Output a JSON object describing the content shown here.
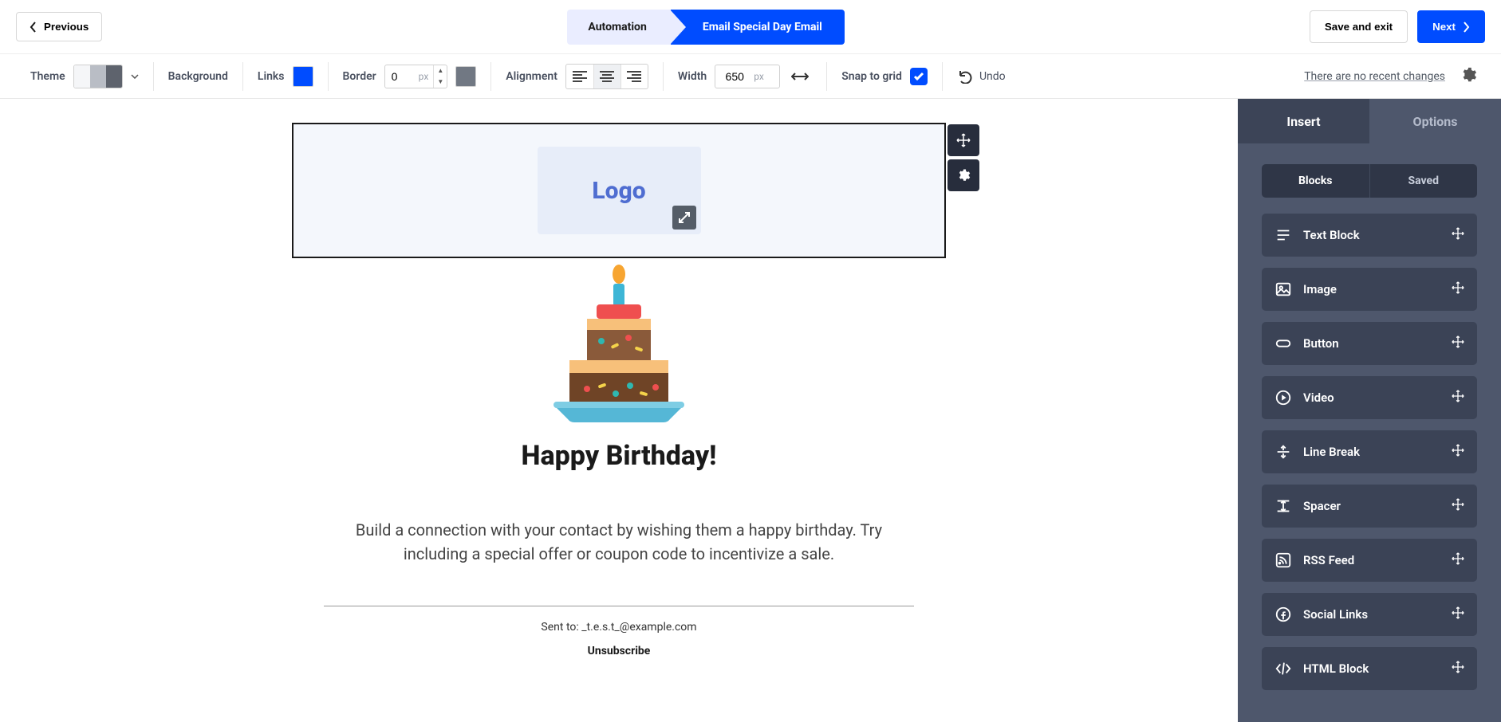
{
  "topbar": {
    "previous_label": "Previous",
    "breadcrumb_left": "Automation",
    "breadcrumb_right": "Email Special Day Email",
    "save_exit_label": "Save and exit",
    "next_label": "Next"
  },
  "toolbar": {
    "theme_label": "Theme",
    "background_label": "Background",
    "links_label": "Links",
    "links_color": "#004cff",
    "border_label": "Border",
    "border_value": "0",
    "border_unit": "px",
    "border_color": "#717883",
    "alignment_label": "Alignment",
    "width_label": "Width",
    "width_value": "650",
    "width_unit": "px",
    "snap_label": "Snap to grid",
    "snap_checked": true,
    "undo_label": "Undo",
    "changes_text": "There are no recent changes"
  },
  "canvas": {
    "logo_text": "Logo",
    "headline": "Happy Birthday!",
    "body_copy": "Build a connection with your contact by wishing them a happy birthday. Try including a special offer or coupon code to incentivize a sale.",
    "sent_to_prefix": "Sent to: ",
    "sent_to_email": "_t.e.s.t_@example.com",
    "unsubscribe_label": "Unsubscribe"
  },
  "panel": {
    "tabs": {
      "insert": "Insert",
      "options": "Options"
    },
    "segment": {
      "blocks": "Blocks",
      "saved": "Saved"
    },
    "blocks": [
      {
        "icon": "text",
        "label": "Text Block"
      },
      {
        "icon": "image",
        "label": "Image"
      },
      {
        "icon": "button",
        "label": "Button"
      },
      {
        "icon": "video",
        "label": "Video"
      },
      {
        "icon": "line",
        "label": "Line Break"
      },
      {
        "icon": "spacer",
        "label": "Spacer"
      },
      {
        "icon": "rss",
        "label": "RSS Feed"
      },
      {
        "icon": "social",
        "label": "Social Links"
      },
      {
        "icon": "html",
        "label": "HTML Block"
      }
    ]
  }
}
